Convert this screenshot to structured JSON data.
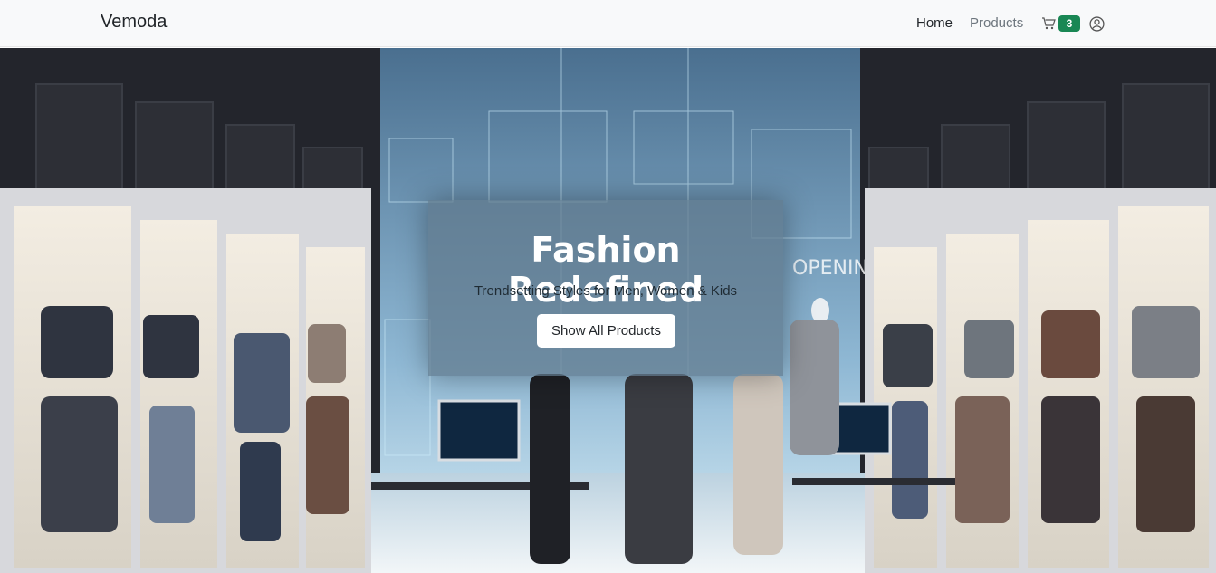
{
  "navbar": {
    "brand": "Vemoda",
    "links": [
      {
        "label": "Home"
      },
      {
        "label": "Products"
      }
    ],
    "cart_count": "3",
    "cart_icon": "cart-icon",
    "user_icon": "user-circle-icon",
    "badge_color": "#198754"
  },
  "hero": {
    "title": "Fashion Redefined",
    "subtitle": "Trendsetting Styles for Men, Women & Kids",
    "button_label": "Show All Products",
    "background": "futuristic clothing store image",
    "screen_text": "OPENING"
  }
}
